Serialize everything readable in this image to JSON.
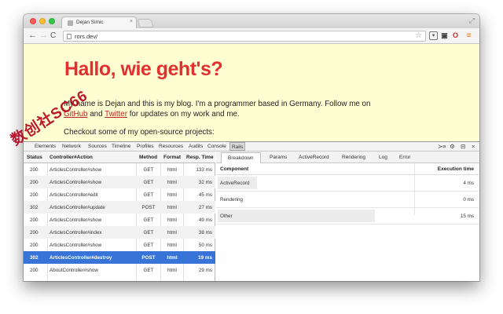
{
  "browser": {
    "tab_title": "Dejan Simic",
    "tab_close": "×",
    "url": "rors.dev/",
    "fullscreen_glyph": "⤢",
    "back": "←",
    "forward": "→",
    "reload": "C",
    "star": "☆",
    "ext_icons": [
      "pocket-icon",
      "ghostery-icon",
      "opera-icon",
      "menu-icon"
    ]
  },
  "page": {
    "heading": "Hallo, wie geht's?",
    "intro_before_github": "My name is Dejan and this is my blog. I'm a programmer based in Germany. Follow me on ",
    "github": "GitHub",
    "and": " and ",
    "twitter": "Twitter",
    "intro_after": " for updates on my work and me.",
    "projects": "Checkout some of my open-source projects:"
  },
  "devtools": {
    "tabs": [
      "Elements",
      "Network",
      "Sources",
      "Timeline",
      "Profiles",
      "Resources",
      "Audits",
      "Console",
      "Rails"
    ],
    "active_tab": "Rails",
    "right_icons": [
      "≻≡",
      "⚙",
      "⊟",
      "×"
    ]
  },
  "requests": {
    "columns": [
      "Status",
      "Controller#Action",
      "Method",
      "Format",
      "Resp. Time"
    ],
    "rows": [
      {
        "status": "200",
        "action": "ArticlesController#show",
        "method": "GET",
        "format": "html",
        "time": "133 ms"
      },
      {
        "status": "200",
        "action": "ArticlesController#show",
        "method": "GET",
        "format": "html",
        "time": "32 ms"
      },
      {
        "status": "200",
        "action": "ArticlesController#edit",
        "method": "GET",
        "format": "html",
        "time": "45 ms"
      },
      {
        "status": "302",
        "action": "ArticlesController#update",
        "method": "POST",
        "format": "html",
        "time": "27 ms"
      },
      {
        "status": "200",
        "action": "ArticlesController#show",
        "method": "GET",
        "format": "html",
        "time": "49 ms"
      },
      {
        "status": "200",
        "action": "ArticlesController#index",
        "method": "GET",
        "format": "html",
        "time": "38 ms"
      },
      {
        "status": "200",
        "action": "ArticlesController#show",
        "method": "GET",
        "format": "html",
        "time": "50 ms"
      },
      {
        "status": "302",
        "action": "ArticlesController#destroy",
        "method": "POST",
        "format": "html",
        "time": "19 ms"
      },
      {
        "status": "200",
        "action": "AboutController#show",
        "method": "GET",
        "format": "html",
        "time": "29 ms"
      }
    ],
    "selected_index": 7
  },
  "detail": {
    "tabs": [
      "Breakdown",
      "Params",
      "ActiveRecord",
      "Rendering",
      "Log",
      "Error"
    ],
    "active_tab": "Breakdown",
    "header_component": "Component",
    "header_time": "Execution time",
    "rows": [
      {
        "component": "ActiveRecord",
        "time": "4 ms",
        "share": 0.2
      },
      {
        "component": "Rendering",
        "time": "0 ms",
        "share": 0.0
      },
      {
        "component": "Other",
        "time": "15 ms",
        "share": 0.8
      }
    ]
  },
  "watermark": "数创社SC66"
}
